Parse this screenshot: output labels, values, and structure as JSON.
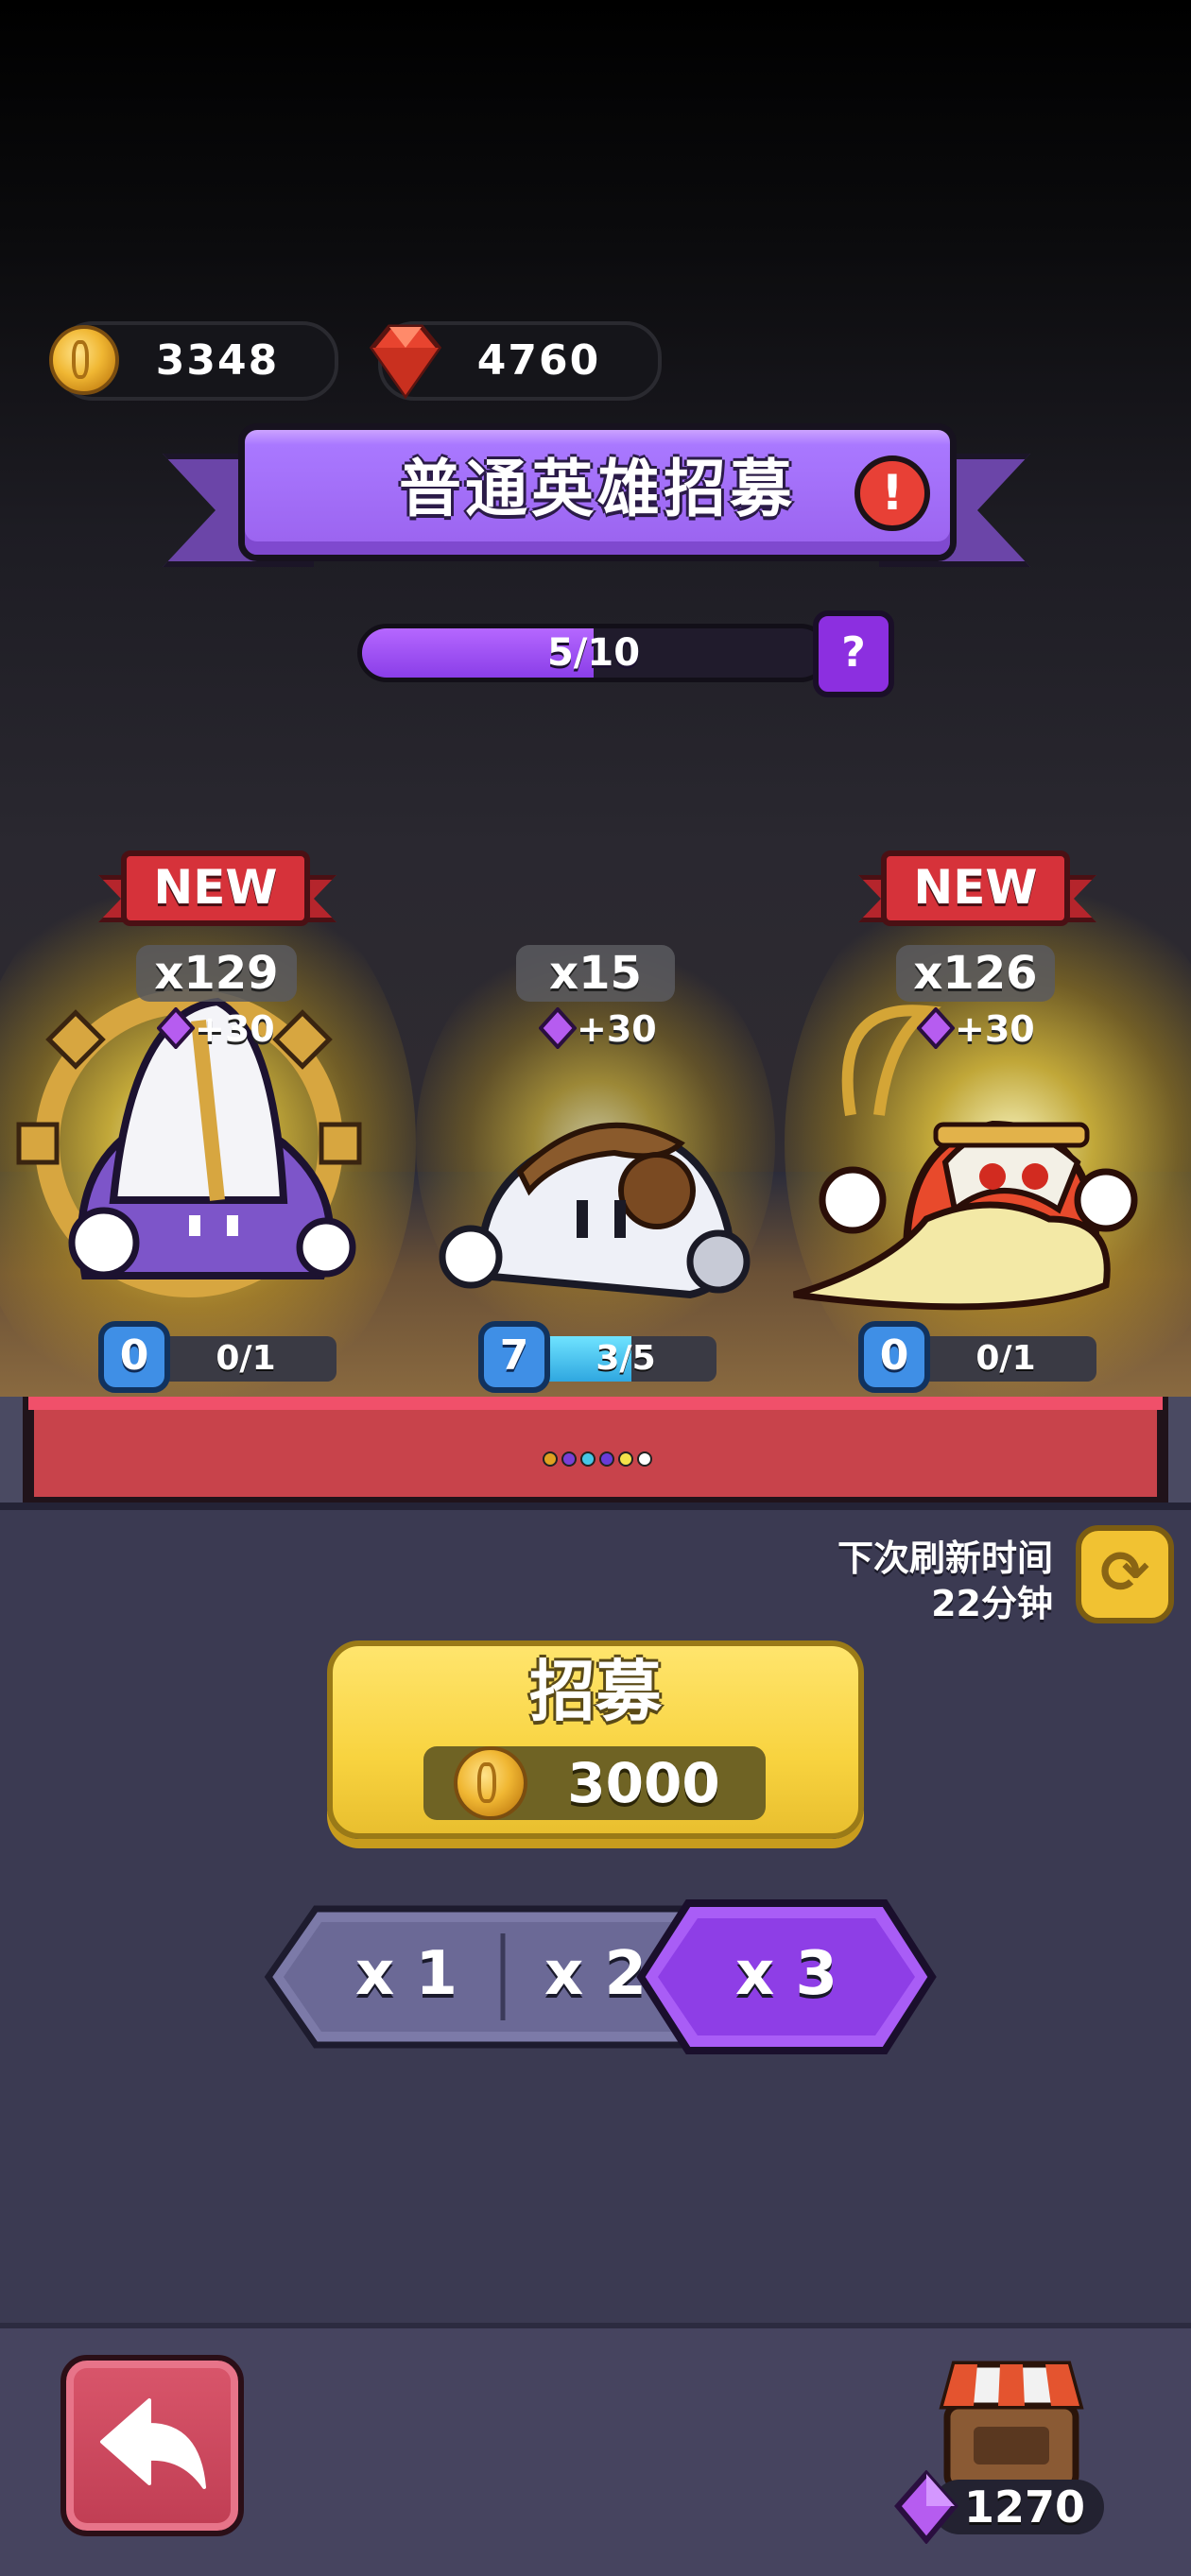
{
  "currency": {
    "gold": "3348",
    "ruby": "4760"
  },
  "banner": {
    "title": "普通英雄招募"
  },
  "progress": {
    "text": "5/10",
    "value": 0.5
  },
  "heroes": [
    {
      "badge": "NEW",
      "count": "x129",
      "gem_bonus": "+30",
      "level": "0",
      "shards": "0/1",
      "shard_progress": 0.0
    },
    {
      "badge": "",
      "count": "x15",
      "gem_bonus": "+30",
      "level": "7",
      "shards": "3/5",
      "shard_progress": 0.6
    },
    {
      "badge": "NEW",
      "count": "x126",
      "gem_bonus": "+30",
      "level": "0",
      "shards": "0/1",
      "shard_progress": 0.0
    }
  ],
  "page_dots": [
    "#e0a020",
    "#7a3fd6",
    "#46c7e6",
    "#6a3bd8",
    "#f4e24a",
    "#ffffff"
  ],
  "refresh": {
    "line1": "下次刷新时间",
    "line2": "22分钟"
  },
  "recruit": {
    "label": "招募",
    "cost": "3000"
  },
  "multipliers": {
    "options": [
      "x 1",
      "x 2",
      "x 3"
    ],
    "selected": "x 3"
  },
  "shop": {
    "gems": "1270"
  },
  "colors": {
    "accent_purple": "#8c2fe0",
    "recruit_yellow": "#f8d33f",
    "back_red": "#c8434b"
  }
}
